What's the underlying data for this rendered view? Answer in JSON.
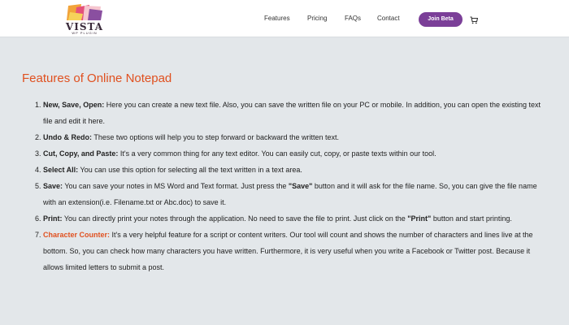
{
  "nav": {
    "logo_text": "VISTA",
    "logo_subtext": "WP PLUGIN",
    "links": [
      "Features",
      "Pricing",
      "FAQs",
      "Contact"
    ],
    "cta_label": "Join Beta",
    "cart_icon": "cart-icon"
  },
  "colors": {
    "accent": "#e0501f",
    "brand_purple": "#7b3f98",
    "page_bg": "#e3e7ea"
  },
  "content": {
    "heading": "Features of Online Notepad",
    "items": [
      {
        "term": "New, Save, Open:",
        "parts": [
          " Here you can create a new text file. Also, you can save the written file on your PC or mobile. In addition, you can open the existing text file and edit it here."
        ]
      },
      {
        "term": "Undo & Redo:",
        "parts": [
          " These two options will help you to step forward or backward the written text."
        ]
      },
      {
        "term": "Cut, Copy, and Paste:",
        "parts": [
          " It's a very common thing for any text editor. You can easily cut, copy, or paste texts within our tool."
        ]
      },
      {
        "term": "Select All:",
        "parts": [
          " You can use this option for selecting all the text written in a text area."
        ]
      },
      {
        "term": "Save:",
        "parts": [
          " You can save your notes in MS Word and Text format. Just press the ",
          " button and it will ask for the file name. So, you can give the file name with an extension(i.e. Filename.txt or Abc.doc) to save it."
        ],
        "quoted": "\"Save\""
      },
      {
        "term": "Print:",
        "parts": [
          " You can directly print your notes through the application. No need to save the file to print. Just click on the ",
          " button and start printing."
        ],
        "quoted": "\"Print\""
      },
      {
        "term": "Character Counter:",
        "accent": true,
        "parts": [
          " It's a very helpful feature for a script or content writers. Our tool will count and shows the number of characters and lines live at the bottom. So, you can check how many characters you have written. Furthermore, it is very useful when you write a Facebook or Twitter post. Because it allows limited letters to submit a post."
        ]
      }
    ]
  }
}
